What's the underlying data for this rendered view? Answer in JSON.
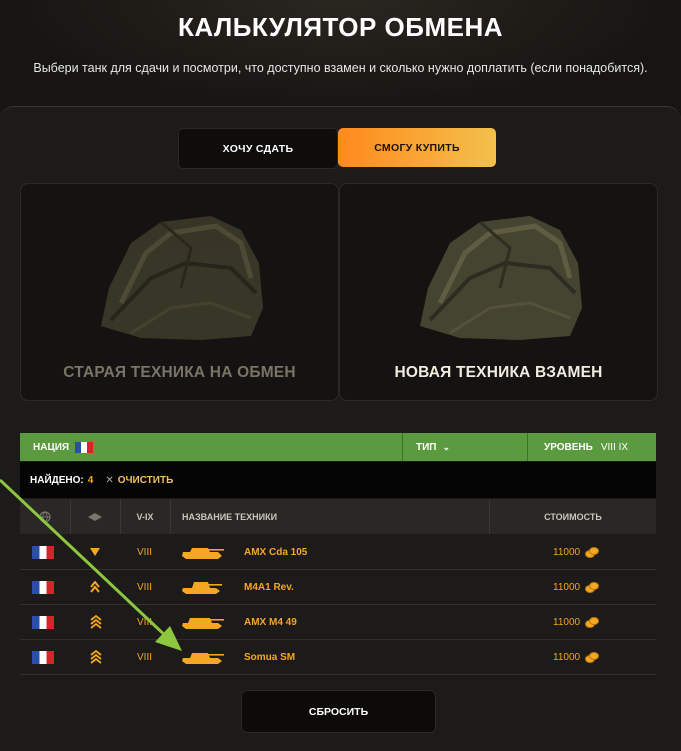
{
  "header": {
    "title": "КАЛЬКУЛЯТОР ОБМЕНА",
    "subtitle": "Выбери танк для сдачи и посмотри, что доступно взамен и сколько нужно доплатить (если понадобится)."
  },
  "tabs": [
    {
      "label": "ХОЧУ СДАТЬ",
      "active": false
    },
    {
      "label": "СМОГУ КУПИТЬ",
      "active": true
    }
  ],
  "cards": {
    "old_label": "СТАРАЯ ТЕХНИКА НА ОБМЕН",
    "new_label": "НОВАЯ ТЕХНИКА ВЗАМЕН"
  },
  "filters": {
    "nation_label": "НАЦИЯ",
    "type_label": "ТИП",
    "level_label": "УРОВЕНЬ",
    "level_value": "VIII IX"
  },
  "results": {
    "found_label": "НАЙДЕНО:",
    "found_count": "4",
    "clear_label": "ОЧИСТИТЬ"
  },
  "table": {
    "columns": {
      "tier": "V-IX",
      "name": "НАЗВАНИЕ ТЕХНИКИ",
      "cost": "СТОИМОСТЬ"
    },
    "rows": [
      {
        "tier": "VIII",
        "name": "AMX Cda 105",
        "cost": "11000",
        "type_icon": "td-triangle-icon"
      },
      {
        "tier": "VIII",
        "name": "M4A1 Rev.",
        "cost": "11000",
        "type_icon": "medium-tank-icon"
      },
      {
        "tier": "VIII",
        "name": "AMX M4 49",
        "cost": "11000",
        "type_icon": "heavy-tank-icon"
      },
      {
        "tier": "VIII",
        "name": "Somua SM",
        "cost": "11000",
        "type_icon": "heavy-tank-icon"
      }
    ]
  },
  "actions": {
    "reset_label": "СБРОСИТЬ"
  },
  "colors": {
    "accent_orange": "#f5a623",
    "filter_green": "#5b9a3f",
    "arrow_green": "#8dc63f"
  }
}
